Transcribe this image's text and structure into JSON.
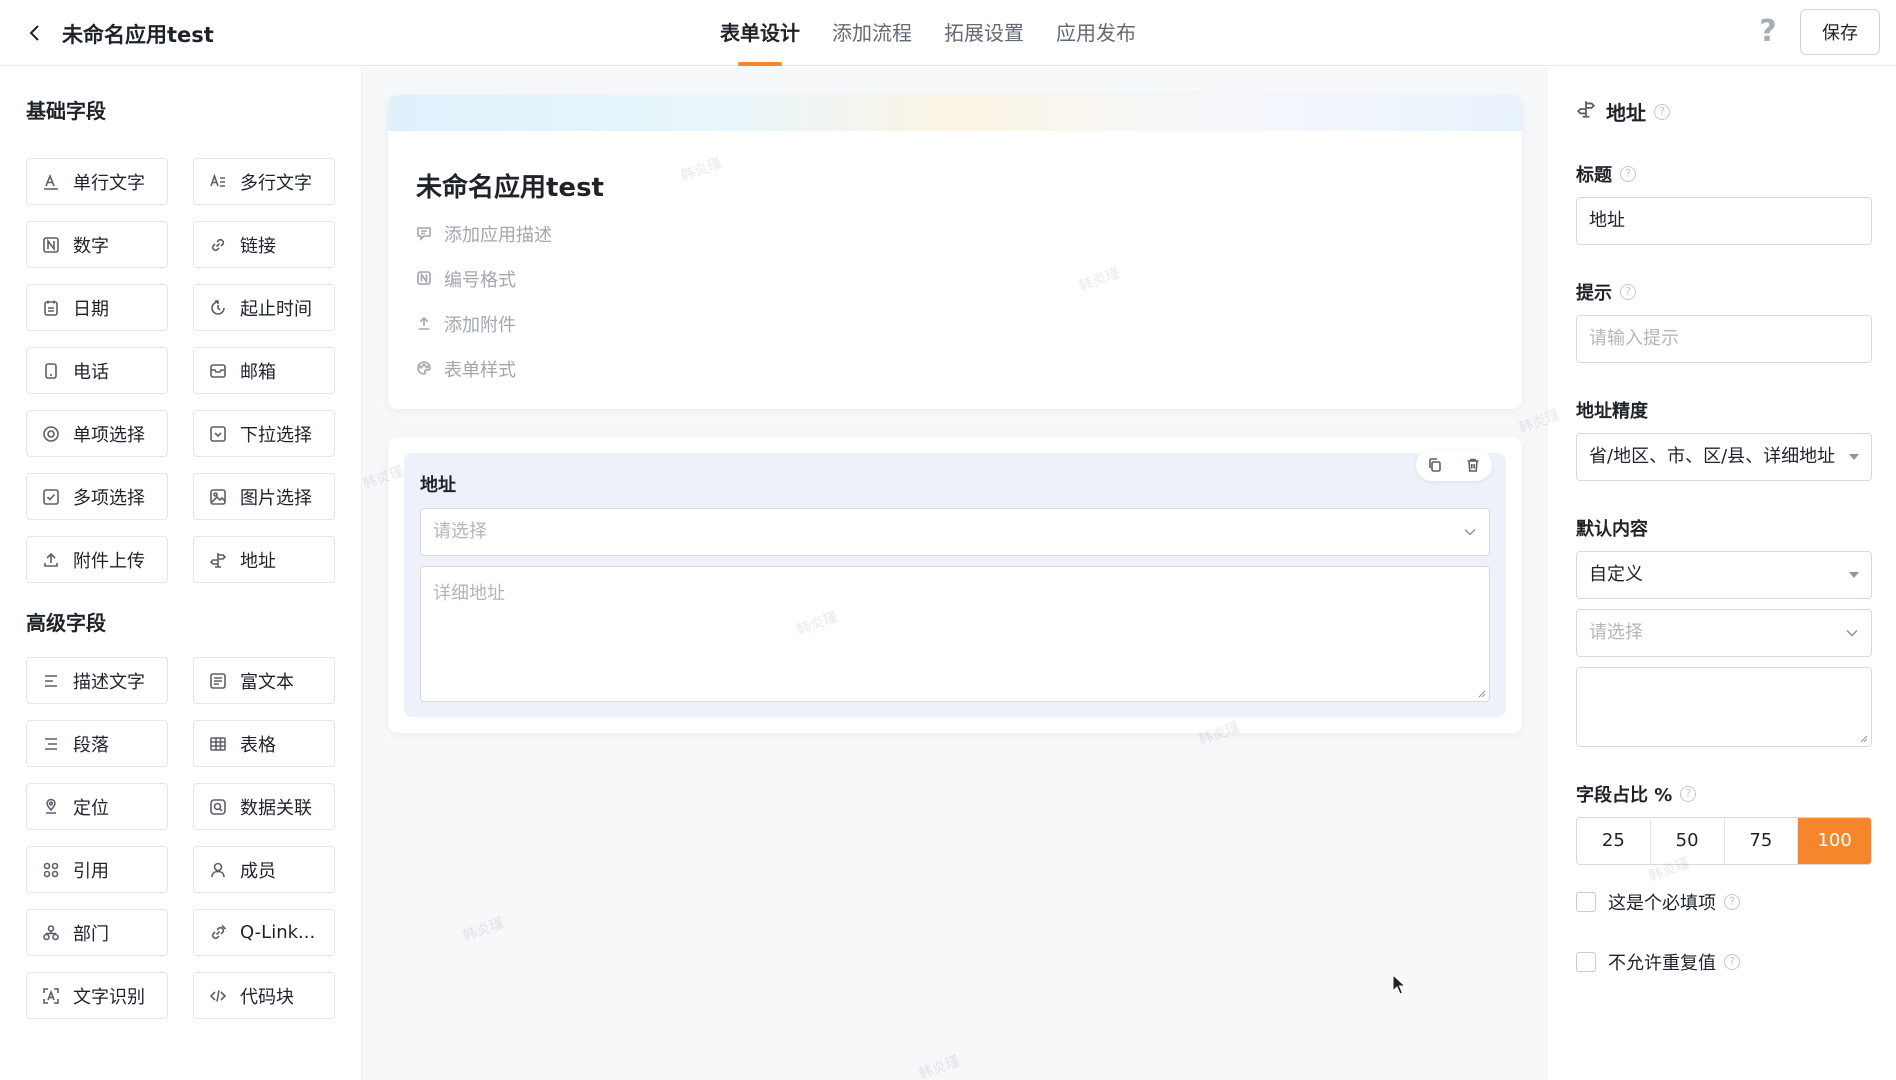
{
  "header": {
    "app_title": "未命名应用test",
    "tabs": [
      "表单设计",
      "添加流程",
      "拓展设置",
      "应用发布"
    ],
    "active_tab": "表单设计",
    "help": "?",
    "save_label": "保存"
  },
  "sidebar": {
    "basic_title": "基础字段",
    "basic_fields": [
      {
        "label": "单行文字",
        "icon": "single-line-text-icon"
      },
      {
        "label": "多行文字",
        "icon": "multi-line-text-icon"
      },
      {
        "label": "数字",
        "icon": "number-icon"
      },
      {
        "label": "链接",
        "icon": "link-icon"
      },
      {
        "label": "日期",
        "icon": "calendar-icon"
      },
      {
        "label": "起止时间",
        "icon": "time-range-icon"
      },
      {
        "label": "电话",
        "icon": "phone-icon"
      },
      {
        "label": "邮箱",
        "icon": "mail-icon"
      },
      {
        "label": "单项选择",
        "icon": "radio-icon"
      },
      {
        "label": "下拉选择",
        "icon": "dropdown-icon"
      },
      {
        "label": "多项选择",
        "icon": "checkbox-icon"
      },
      {
        "label": "图片选择",
        "icon": "image-icon"
      },
      {
        "label": "附件上传",
        "icon": "upload-icon"
      },
      {
        "label": "地址",
        "icon": "signpost-icon"
      }
    ],
    "advanced_title": "高级字段",
    "advanced_fields": [
      {
        "label": "描述文字",
        "icon": "description-icon"
      },
      {
        "label": "富文本",
        "icon": "rich-text-icon"
      },
      {
        "label": "段落",
        "icon": "paragraph-icon"
      },
      {
        "label": "表格",
        "icon": "table-icon"
      },
      {
        "label": "定位",
        "icon": "location-icon"
      },
      {
        "label": "数据关联",
        "icon": "data-link-icon"
      },
      {
        "label": "引用",
        "icon": "reference-icon"
      },
      {
        "label": "成员",
        "icon": "member-icon"
      },
      {
        "label": "部门",
        "icon": "department-icon"
      },
      {
        "label": "Q-Link...",
        "icon": "q-link-icon"
      },
      {
        "label": "文字识别",
        "icon": "ocr-icon"
      },
      {
        "label": "代码块",
        "icon": "code-icon"
      }
    ]
  },
  "canvas": {
    "form_title": "未命名应用test",
    "form_items": [
      "添加应用描述",
      "编号格式",
      "添加附件",
      "表单样式"
    ],
    "field": {
      "label": "地址",
      "select_placeholder": "请选择",
      "detail_placeholder": "详细地址"
    },
    "watermark": "韩炎瑾"
  },
  "properties": {
    "field_name": "地址",
    "title_label": "标题",
    "title_value": "地址",
    "hint_label": "提示",
    "hint_placeholder": "请输入提示",
    "precision_label": "地址精度",
    "precision_value": "省/地区、市、区/县、详细地址",
    "default_label": "默认内容",
    "default_value": "自定义",
    "default_select_placeholder": "请选择",
    "ratio_label": "字段占比 %",
    "ratio_options": [
      "25",
      "50",
      "75",
      "100"
    ],
    "ratio_selected": "100",
    "required_label": "这是个必填项",
    "unique_label": "不允许重复值"
  },
  "colors": {
    "accent": "#f5862b",
    "field_block_bg": "#eef1fa",
    "canvas_bg": "#f7f8fa"
  }
}
